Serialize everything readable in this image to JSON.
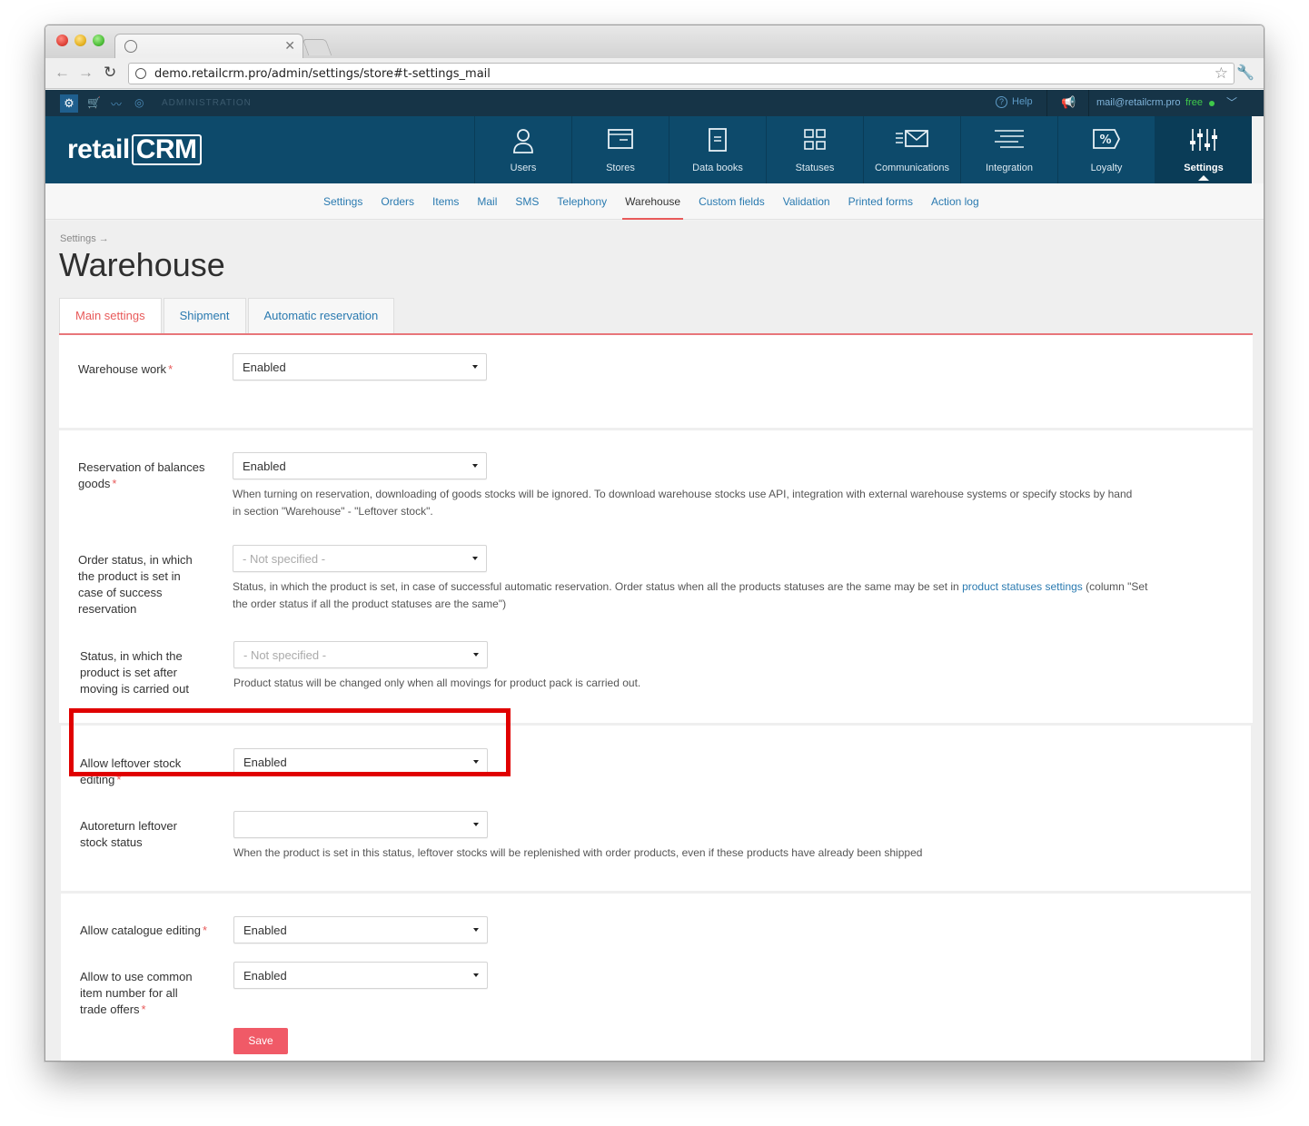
{
  "browser": {
    "url": "demo.retailcrm.pro/admin/settings/store#t-settings_mail"
  },
  "admin_bar": {
    "label": "ADMINISTRATION",
    "help": "Help",
    "email": "mail@retailcrm.pro",
    "plan": "free"
  },
  "logo": {
    "text_left": "retail",
    "text_right": "CRM"
  },
  "main_nav": [
    {
      "label": "Users",
      "icon": "user-icon"
    },
    {
      "label": "Stores",
      "icon": "stores-icon"
    },
    {
      "label": "Data books",
      "icon": "data-books-icon"
    },
    {
      "label": "Statuses",
      "icon": "statuses-icon"
    },
    {
      "label": "Communications",
      "icon": "communications-icon"
    },
    {
      "label": "Integration",
      "icon": "integration-icon"
    },
    {
      "label": "Loyalty",
      "icon": "loyalty-icon"
    },
    {
      "label": "Settings",
      "icon": "settings-sliders-icon",
      "active": true
    }
  ],
  "sub_nav": [
    "Settings",
    "Orders",
    "Items",
    "Mail",
    "SMS",
    "Telephony",
    "Warehouse",
    "Custom fields",
    "Validation",
    "Printed forms",
    "Action log"
  ],
  "sub_nav_active": "Warehouse",
  "breadcrumb": "Settings →",
  "page_title": "Warehouse",
  "tabs": [
    "Main settings",
    "Shipment",
    "Automatic reservation"
  ],
  "active_tab": "Main settings",
  "fields": {
    "warehouse_work": {
      "label": "Warehouse work",
      "value": "Enabled"
    },
    "reservation": {
      "label": "Reservation of balances goods",
      "value": "Enabled",
      "hint": "When turning on reservation, downloading of goods stocks will be ignored. To download warehouse stocks use API, integration with external warehouse systems or specify stocks by hand in section \"Warehouse\" - \"Leftover stock\"."
    },
    "order_status": {
      "label": "Order status, in which the product is set in case of success reservation",
      "value": "- Not specified -",
      "hint_before": "Status, in which the product is set, in case of successful automatic reservation. Order status when all the products statuses are the same may be set in ",
      "hint_link": "product statuses settings",
      "hint_after": " (column \"Set the order status if all the product statuses are the same\")"
    },
    "moving_status": {
      "label": "Status, in which the product is set after moving is carried out",
      "value": "- Not specified -",
      "hint": "Product status will be changed only when all movings for product pack is carried out."
    },
    "leftover_editing": {
      "label": "Allow leftover stock editing",
      "value": "Enabled"
    },
    "autoreturn": {
      "label": "Autoreturn leftover stock status",
      "value": "",
      "hint": "When the product is set in this status, leftover stocks will be replenished with order products, even if these products have already been shipped"
    },
    "catalogue_editing": {
      "label": "Allow catalogue editing",
      "value": "Enabled"
    },
    "common_item_number": {
      "label": "Allow to use common item number for all trade offers",
      "value": "Enabled"
    }
  },
  "save_label": "Save",
  "colors": {
    "header": "#0d4a6b",
    "admin_strip": "#163447",
    "accent_red": "#e85a5a",
    "link_blue": "#2a7ab0",
    "highlight": "#e00000",
    "save_button": "#f05a67"
  }
}
